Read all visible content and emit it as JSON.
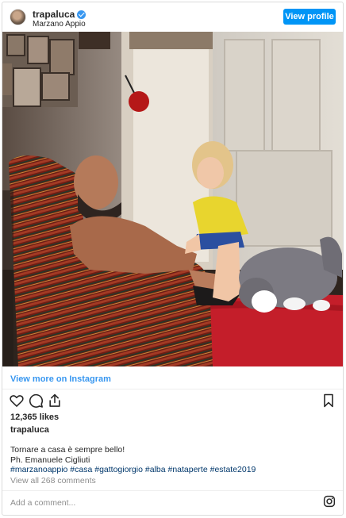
{
  "header": {
    "username": "trapaluca",
    "location": "Marzano Appio",
    "view_profile_label": "View profile"
  },
  "photo": {
    "description_icon": "photo-of-man-child-and-cat"
  },
  "view_more_label": "View more on Instagram",
  "actions": {
    "like_icon": "heart-icon",
    "comment_icon": "comment-icon",
    "share_icon": "share-icon",
    "save_icon": "bookmark-icon"
  },
  "likes": "12,365 likes",
  "owner": "trapaluca",
  "caption": {
    "line1": "Tornare a casa è sempre bello!",
    "line2": "Ph. Emanuele Cigliuti",
    "hashtags": "#marzanoappio #casa #gattogiorgio #alba #nataperte #estate2019"
  },
  "view_all_comments": "View all 268 comments",
  "comment_placeholder": "Add a comment...",
  "colors": {
    "accent": "#0095f6",
    "link": "#3897f0",
    "muted": "#8e8e8e"
  }
}
